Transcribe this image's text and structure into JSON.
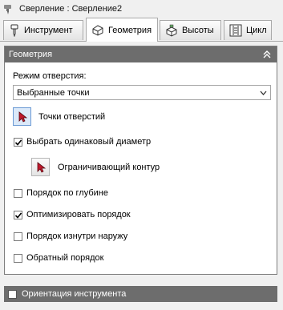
{
  "title": "Сверление : Сверление2",
  "tabs": [
    {
      "label": "Инструмент",
      "icon": "tool-icon",
      "active": false
    },
    {
      "label": "Геометрия",
      "icon": "geometry-icon",
      "active": true
    },
    {
      "label": "Высоты",
      "icon": "heights-icon",
      "active": false
    },
    {
      "label": "Цикл",
      "icon": "cycle-icon",
      "active": false
    }
  ],
  "panel": {
    "title": "Геометрия",
    "hole_mode_label": "Режим отверстия:",
    "hole_mode_value": "Выбранные точки",
    "hole_points_label": "Точки отверстий",
    "same_diameter_label": "Выбрать одинаковый диаметр",
    "same_diameter_checked": true,
    "boundary_label": "Ограничивающий контур",
    "checkboxes": [
      {
        "label": "Порядок по глубине",
        "checked": false
      },
      {
        "label": "Оптимизировать порядок",
        "checked": true
      },
      {
        "label": "Порядок изнутри наружу",
        "checked": false
      },
      {
        "label": "Обратный порядок",
        "checked": false
      }
    ]
  },
  "tool_orientation_label": "Ориентация инструмента",
  "colors": {
    "header": "#6d6d6d",
    "pick_selected": "#dbe9f9",
    "pointer_red": "#c0182c"
  }
}
